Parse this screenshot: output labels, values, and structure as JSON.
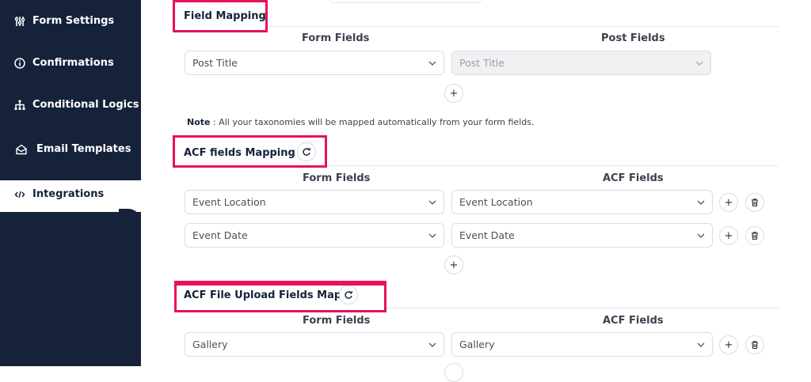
{
  "sidebar": {
    "items": [
      {
        "label": "Form Settings",
        "icon": "sliders-icon"
      },
      {
        "label": "Confirmations",
        "icon": "info-circle-icon"
      },
      {
        "label": "Conditional Logics",
        "icon": "sitemap-icon"
      },
      {
        "label": "Email Templates",
        "icon": "envelope-open-icon"
      },
      {
        "label": "Integrations",
        "icon": "code-icon",
        "active": true
      }
    ]
  },
  "field_mapping": {
    "title": "Field Mapping",
    "form_fields_header": "Form Fields",
    "post_fields_header": "Post Fields",
    "rows": [
      {
        "form_field": "Post Title",
        "post_field": "Post Title"
      }
    ],
    "add_label": "+"
  },
  "note": {
    "label": "Note",
    "text": " : All your taxonomies will be mapped automatically from your form fields."
  },
  "acf_mapping": {
    "title": "ACF fields Mapping",
    "form_fields_header": "Form Fields",
    "acf_fields_header": "ACF Fields",
    "rows": [
      {
        "form_field": "Event Location",
        "acf_field": "Event Location"
      },
      {
        "form_field": "Event Date",
        "acf_field": "Event Date"
      }
    ],
    "add_label": "+"
  },
  "acf_file_upload": {
    "title": "ACF File Upload Fields Map",
    "form_fields_header": "Form Fields",
    "acf_fields_header": "ACF Fields",
    "rows": [
      {
        "form_field": "Gallery",
        "acf_field": "Gallery"
      }
    ]
  },
  "colors": {
    "sidebar_bg": "#16223a",
    "highlight": "#e8115b"
  }
}
